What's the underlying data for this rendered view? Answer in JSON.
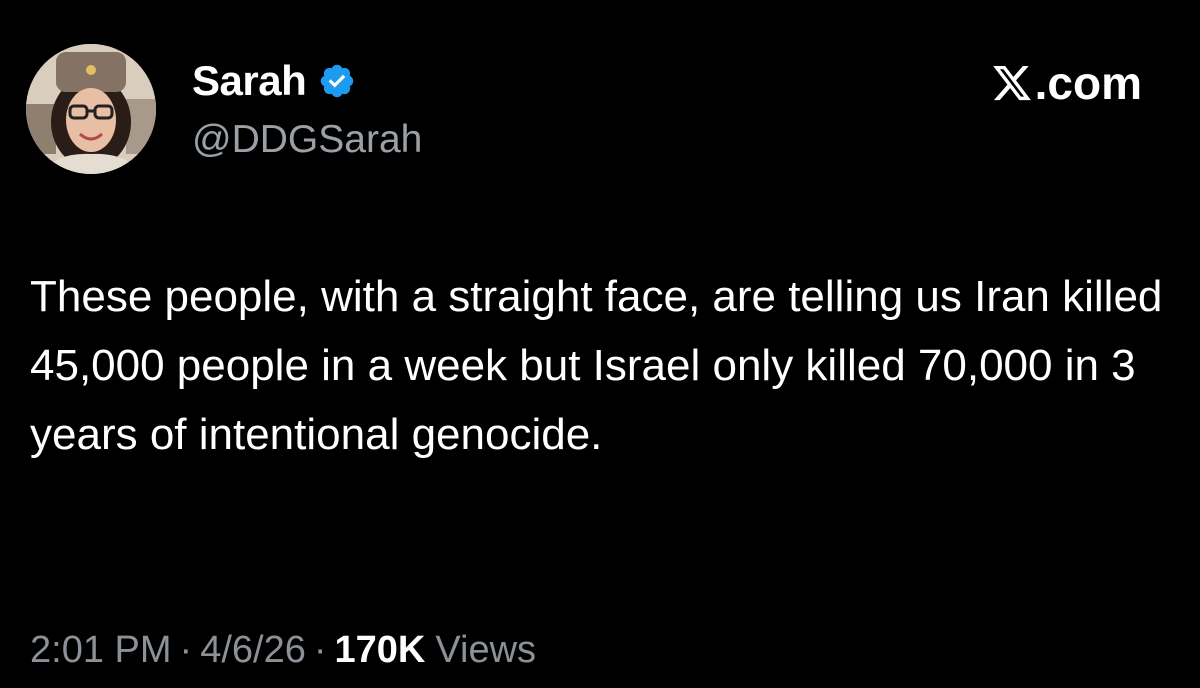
{
  "author": {
    "display_name": "Sarah",
    "handle": "@DDGSarah",
    "verified_icon": "verified-badge-icon",
    "avatar": "profile-photo"
  },
  "site": {
    "logo_icon": "x-logo-icon",
    "label": ".com"
  },
  "tweet": {
    "text": "These people, with a straight face, are telling us Iran killed 45,000 people in a week but Israel only killed 70,000 in 3 years of intentional genocide."
  },
  "meta": {
    "time": "2:01 PM",
    "separator": "·",
    "date": "4/6/26",
    "views_count": "170K",
    "views_label": "Views"
  },
  "colors": {
    "background": "#000000",
    "text": "#ffffff",
    "secondary": "#8b9196",
    "verified": "#1d9bf0"
  }
}
